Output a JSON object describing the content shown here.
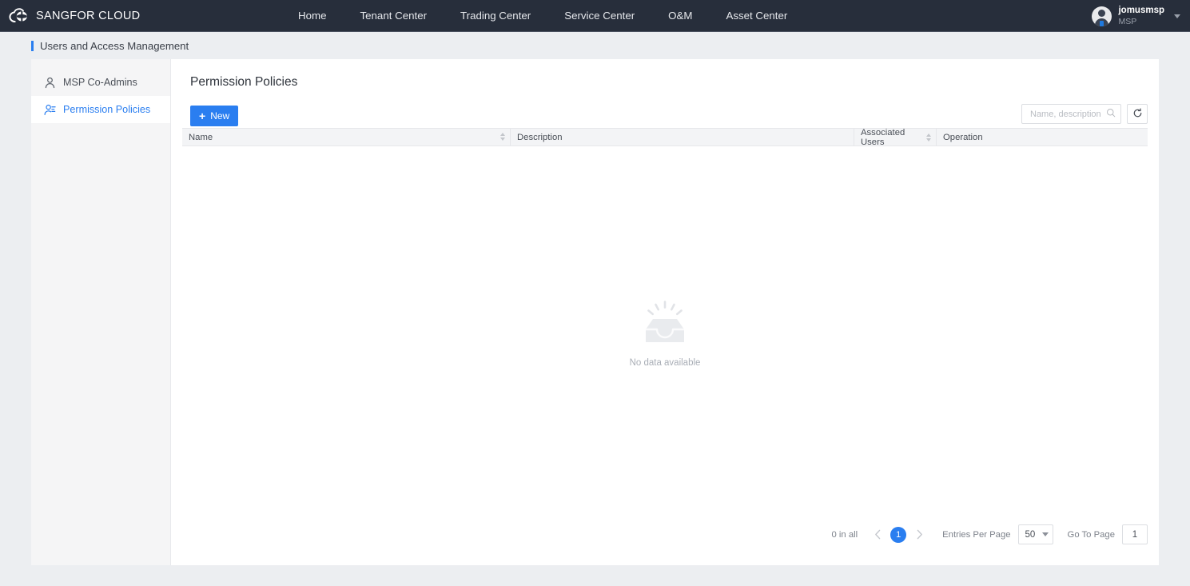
{
  "topbar": {
    "brand": "SANGFOR CLOUD",
    "logo_icon": "cloud-globe-logo",
    "nav": [
      {
        "label": "Home"
      },
      {
        "label": "Tenant Center"
      },
      {
        "label": "Trading Center"
      },
      {
        "label": "Service Center"
      },
      {
        "label": "O&M"
      },
      {
        "label": "Asset Center"
      }
    ],
    "user": {
      "name": "jomusmsp",
      "role": "MSP",
      "avatar_icon": "user-avatar-icon",
      "caret_icon": "chevron-down-icon"
    }
  },
  "breadcrumb": {
    "text": "Users and Access Management"
  },
  "sidebar": {
    "items": [
      {
        "label": "MSP Co-Admins",
        "icon": "user-icon",
        "active": false
      },
      {
        "label": "Permission Policies",
        "icon": "user-key-icon",
        "active": true
      }
    ]
  },
  "main": {
    "title": "Permission Policies",
    "toolbar": {
      "new_label": "New",
      "new_plus_icon": "plus-icon",
      "search_placeholder": "Name, description",
      "search_value": "",
      "search_icon": "search-icon",
      "refresh_icon": "refresh-icon"
    },
    "table": {
      "columns": [
        {
          "label": "Name",
          "sortable": true
        },
        {
          "label": "Description",
          "sortable": false
        },
        {
          "label": "Associated Users",
          "sortable": true
        },
        {
          "label": "Operation",
          "sortable": false
        }
      ],
      "rows": [],
      "empty_text": "No data available",
      "empty_icon": "empty-box-icon"
    },
    "pagination": {
      "total_text": "0 in all",
      "prev_icon": "chevron-left-icon",
      "next_icon": "chevron-right-icon",
      "current_page": "1",
      "entries_label": "Entries Per Page",
      "entries_value": "50",
      "entries_caret_icon": "caret-down-icon",
      "goto_label": "Go To Page",
      "goto_value": "1"
    }
  },
  "colors": {
    "topbar_bg": "#272e3b",
    "page_bg": "#eceef1",
    "accent": "#2a7ef0",
    "sidebar_bg": "#f5f5f6",
    "table_header_bg": "#f3f4f6",
    "muted_text": "#a9aeb6"
  }
}
